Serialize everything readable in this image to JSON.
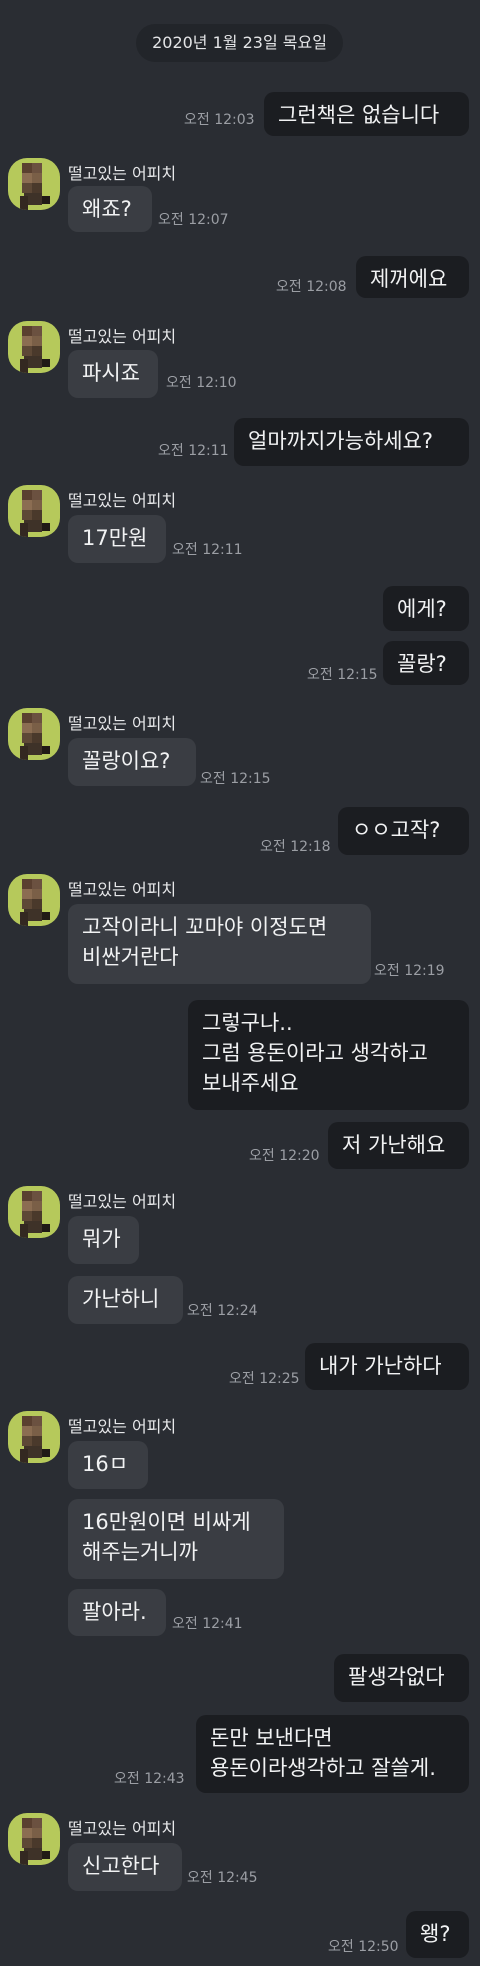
{
  "date_label": "2020년 1월 23일 목요일",
  "sender_name": "떨고있는 어피치",
  "messages": [
    {
      "from": "me",
      "text": "그런책은 없습니다",
      "time": "오전 12:03"
    },
    {
      "from": "them",
      "text": "왜죠?",
      "time": "오전 12:07"
    },
    {
      "from": "me",
      "text": "제꺼에요",
      "time": "오전 12:08"
    },
    {
      "from": "them",
      "text": "파시죠",
      "time": "오전 12:10"
    },
    {
      "from": "me",
      "text": "얼마까지가능하세요?",
      "time": "오전 12:11"
    },
    {
      "from": "them",
      "text": "17만원",
      "time": "오전 12:11"
    },
    {
      "from": "me",
      "text": "에게?",
      "time": ""
    },
    {
      "from": "me",
      "text": "꼴랑?",
      "time": "오전 12:15"
    },
    {
      "from": "them",
      "text": "꼴랑이요?",
      "time": "오전 12:15"
    },
    {
      "from": "me",
      "text": "ㅇㅇ고작?",
      "time": "오전 12:18"
    },
    {
      "from": "them",
      "text": "고작이라니 꼬마야 이정도면\n비싼거란다",
      "time": "오전 12:19"
    },
    {
      "from": "me",
      "text": "그렇구나..\n그럼 용돈이라고 생각하고\n보내주세요",
      "time": ""
    },
    {
      "from": "me",
      "text": "저 가난해요",
      "time": "오전 12:20"
    },
    {
      "from": "them",
      "text": "뭐가",
      "time": ""
    },
    {
      "from": "them",
      "text": "가난하니",
      "time": "오전 12:24"
    },
    {
      "from": "me",
      "text": "내가 가난하다",
      "time": "오전 12:25"
    },
    {
      "from": "them",
      "text": "16ㅁ",
      "time": ""
    },
    {
      "from": "them",
      "text": "16만원이면 비싸게\n해주는거니까",
      "time": ""
    },
    {
      "from": "them",
      "text": "팔아라.",
      "time": "오전 12:41"
    },
    {
      "from": "me",
      "text": "팔생각없다",
      "time": ""
    },
    {
      "from": "me",
      "text": "돈만 보낸다면\n용돈이라생각하고 잘쓸게.",
      "time": "오전 12:43"
    },
    {
      "from": "them",
      "text": "신고한다",
      "time": "오전 12:45"
    },
    {
      "from": "me",
      "text": "왱?",
      "time": "오전 12:50"
    }
  ],
  "colors": {
    "background": "#2a2d33",
    "my_bubble": "#1b1d21",
    "their_bubble": "#3a3d43",
    "text": "#f1f2f3",
    "timestamp": "#9b9ea4",
    "avatar_bg": "#b6c95b"
  },
  "icons": {
    "avatar": "pixelated-profile-icon"
  }
}
